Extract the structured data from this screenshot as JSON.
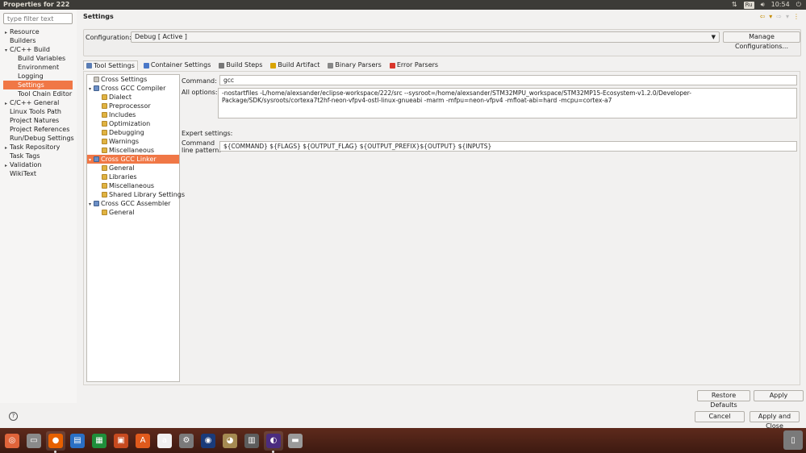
{
  "window": {
    "title": "Properties for 222"
  },
  "tray": {
    "kbd_layout": "Ru",
    "time": "10:54",
    "net_icon": "network-icon",
    "vol_icon": "volume-icon",
    "power_icon": "power-icon"
  },
  "left": {
    "filter_placeholder": "type filter text",
    "items": [
      {
        "label": "Resource",
        "expand": "▸",
        "indent": 0
      },
      {
        "label": "Builders",
        "expand": "",
        "indent": 0
      },
      {
        "label": "C/C++ Build",
        "expand": "▾",
        "indent": 0
      },
      {
        "label": "Build Variables",
        "expand": "",
        "indent": 1
      },
      {
        "label": "Environment",
        "expand": "",
        "indent": 1
      },
      {
        "label": "Logging",
        "expand": "",
        "indent": 1
      },
      {
        "label": "Settings",
        "expand": "",
        "indent": 1,
        "selected": true
      },
      {
        "label": "Tool Chain Editor",
        "expand": "",
        "indent": 1
      },
      {
        "label": "C/C++ General",
        "expand": "▸",
        "indent": 0
      },
      {
        "label": "Linux Tools Path",
        "expand": "",
        "indent": 0
      },
      {
        "label": "Project Natures",
        "expand": "",
        "indent": 0
      },
      {
        "label": "Project References",
        "expand": "",
        "indent": 0
      },
      {
        "label": "Run/Debug Settings",
        "expand": "",
        "indent": 0
      },
      {
        "label": "Task Repository",
        "expand": "▸",
        "indent": 0
      },
      {
        "label": "Task Tags",
        "expand": "",
        "indent": 0
      },
      {
        "label": "Validation",
        "expand": "▸",
        "indent": 0
      },
      {
        "label": "WikiText",
        "expand": "",
        "indent": 0
      }
    ]
  },
  "main": {
    "header": "Settings",
    "config_label": "Configuration:",
    "config_value": "Debug  [ Active ]",
    "manage_label": "Manage Configurations...",
    "tabs": [
      "Tool Settings",
      "Container Settings",
      "Build Steps",
      "Build Artifact",
      "Binary Parsers",
      "Error Parsers"
    ],
    "tab_colors": [
      "#5a7db5",
      "#4a78c8",
      "#777777",
      "#d9a400",
      "#888888",
      "#d9362b"
    ],
    "tools": [
      {
        "label": "Cross Settings",
        "expand": "",
        "indent": 0,
        "icon": "s"
      },
      {
        "label": "Cross GCC Compiler",
        "expand": "▾",
        "indent": 0,
        "icon": "b"
      },
      {
        "label": "Dialect",
        "expand": "",
        "indent": 1,
        "icon": ""
      },
      {
        "label": "Preprocessor",
        "expand": "",
        "indent": 1,
        "icon": ""
      },
      {
        "label": "Includes",
        "expand": "",
        "indent": 1,
        "icon": ""
      },
      {
        "label": "Optimization",
        "expand": "",
        "indent": 1,
        "icon": ""
      },
      {
        "label": "Debugging",
        "expand": "",
        "indent": 1,
        "icon": ""
      },
      {
        "label": "Warnings",
        "expand": "",
        "indent": 1,
        "icon": ""
      },
      {
        "label": "Miscellaneous",
        "expand": "",
        "indent": 1,
        "icon": ""
      },
      {
        "label": "Cross GCC Linker",
        "expand": "▾",
        "indent": 0,
        "icon": "b",
        "selected": true
      },
      {
        "label": "General",
        "expand": "",
        "indent": 1,
        "icon": ""
      },
      {
        "label": "Libraries",
        "expand": "",
        "indent": 1,
        "icon": ""
      },
      {
        "label": "Miscellaneous",
        "expand": "",
        "indent": 1,
        "icon": ""
      },
      {
        "label": "Shared Library Settings",
        "expand": "",
        "indent": 1,
        "icon": ""
      },
      {
        "label": "Cross GCC Assembler",
        "expand": "▾",
        "indent": 0,
        "icon": "b"
      },
      {
        "label": "General",
        "expand": "",
        "indent": 1,
        "icon": ""
      }
    ],
    "command_label": "Command:",
    "command_value": "gcc",
    "options_label": "All options:",
    "options_value": "-nostartfiles -L/home/alexsander/eclipse-workspace/222/src --sysroot=/home/alexsander/STM32MPU_workspace/STM32MP15-Ecosystem-v1.2.0/Developer-Package/SDK/sysroots/cortexa7t2hf-neon-vfpv4-ostl-linux-gnueabi -marm -mfpu=neon-vfpv4 -mfloat-abi=hard -mcpu=cortex-a7",
    "expert_label": "Expert settings:",
    "pattern_label_1": "Command",
    "pattern_label_2": "line pattern:",
    "pattern_value": "${COMMAND} ${FLAGS} ${OUTPUT_FLAG} ${OUTPUT_PREFIX}${OUTPUT} ${INPUTS}",
    "restore_label": "Restore Defaults",
    "apply_label": "Apply"
  },
  "footer": {
    "help": "?",
    "cancel_label": "Cancel",
    "apply_close_label": "Apply and Close"
  },
  "taskbar": {
    "apps": [
      {
        "name": "ubuntu-dash-icon",
        "glyph": "◎",
        "color": "#e0643a"
      },
      {
        "name": "files-icon",
        "glyph": "▭",
        "color": "#8a8a8a"
      },
      {
        "name": "firefox-icon",
        "glyph": "●",
        "color": "#e66000",
        "active": true
      },
      {
        "name": "writer-icon",
        "glyph": "▤",
        "color": "#2a6fc4"
      },
      {
        "name": "calc-icon",
        "glyph": "▦",
        "color": "#1f8f3a"
      },
      {
        "name": "impress-icon",
        "glyph": "▣",
        "color": "#c74a1f"
      },
      {
        "name": "software-center-icon",
        "glyph": "A",
        "color": "#e05a1c"
      },
      {
        "name": "amazon-icon",
        "glyph": "a",
        "color": "#f0f0f0"
      },
      {
        "name": "settings-icon",
        "glyph": "⚙",
        "color": "#7a7a7a"
      },
      {
        "name": "stm32cube-icon",
        "glyph": "◉",
        "color": "#1a3b7a"
      },
      {
        "name": "gimp-icon",
        "glyph": "◕",
        "color": "#a58a52"
      },
      {
        "name": "calculator-icon",
        "glyph": "▥",
        "color": "#5d5d5d"
      },
      {
        "name": "eclipse-icon",
        "glyph": "◐",
        "color": "#4b2c7f",
        "active": true
      },
      {
        "name": "drive-icon",
        "glyph": "▬",
        "color": "#9a9a9a"
      }
    ]
  }
}
